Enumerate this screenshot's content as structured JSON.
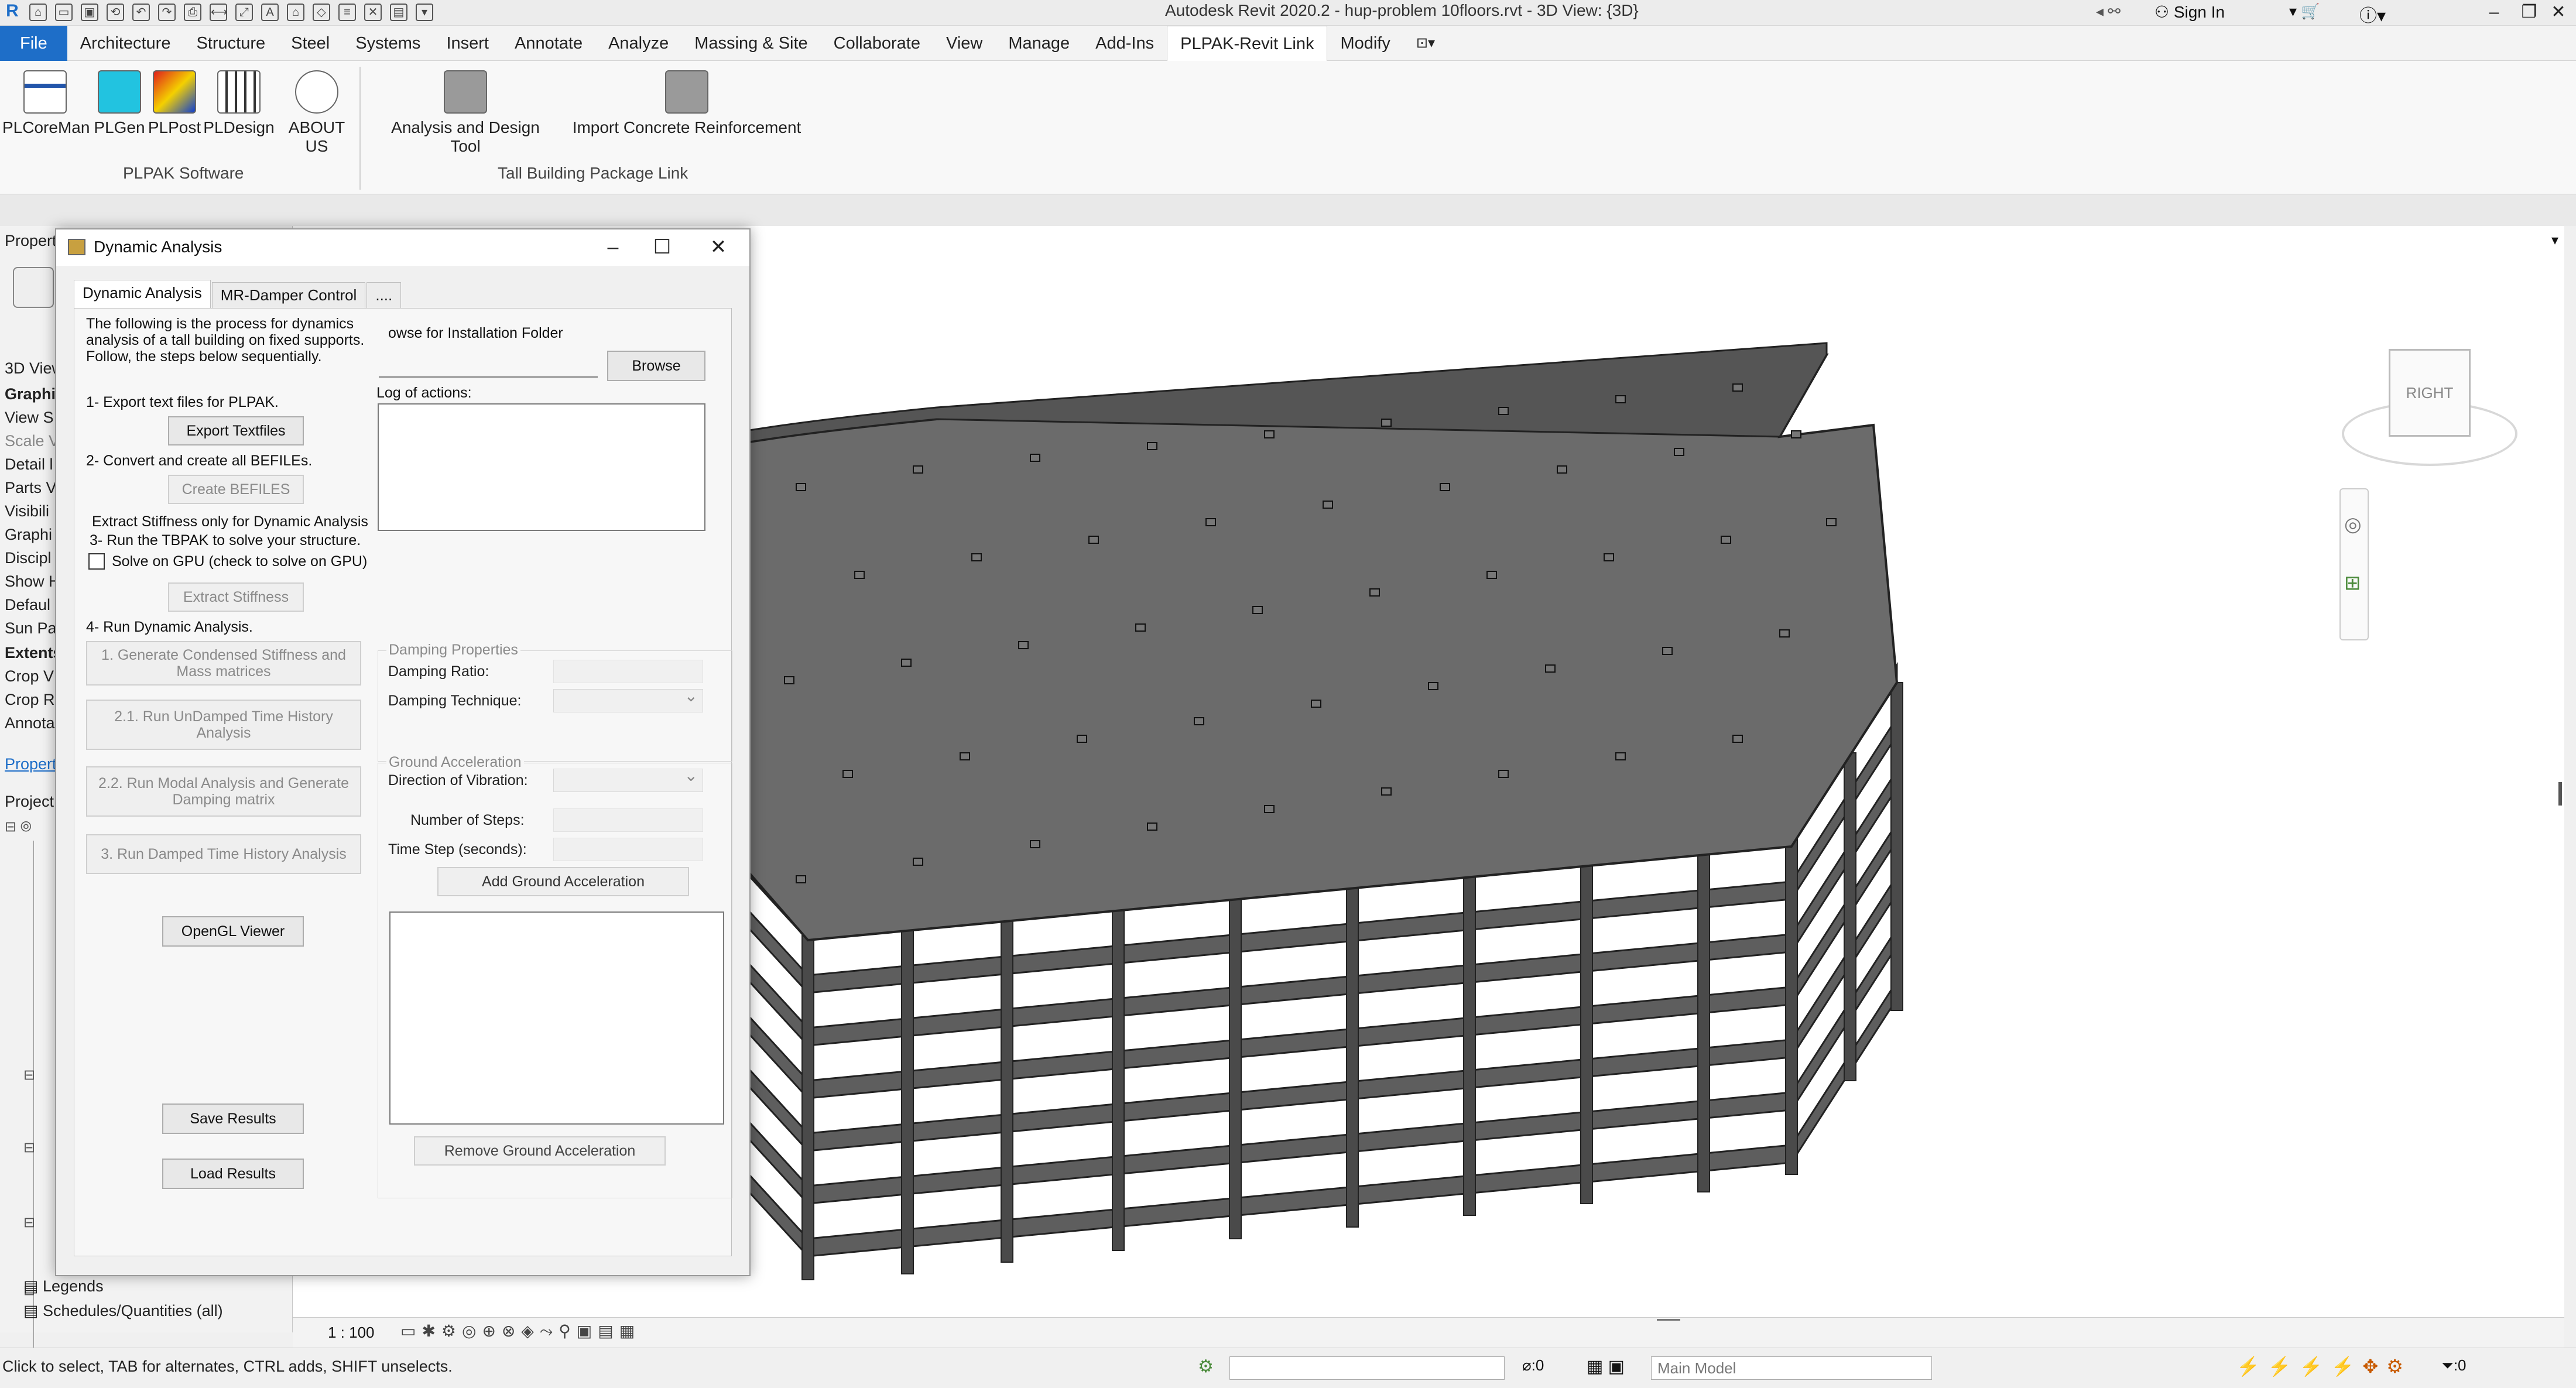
{
  "app": {
    "title": "Autodesk Revit 2020.2 - hup-problem 10floors.rvt - 3D View: {3D}",
    "sign_in": "Sign In"
  },
  "menu": {
    "tabs": [
      "File",
      "Architecture",
      "Structure",
      "Steel",
      "Systems",
      "Insert",
      "Annotate",
      "Analyze",
      "Massing & Site",
      "Collaborate",
      "View",
      "Manage",
      "Add-Ins",
      "PLPAK-Revit Link",
      "Modify"
    ],
    "active": "PLPAK-Revit Link"
  },
  "ribbon": {
    "plpak_buttons": [
      "PLCoreMan",
      "PLGen",
      "PLPost",
      "PLDesign",
      "ABOUT US"
    ],
    "plpak_label": "PLPAK Software",
    "tall_buttons": [
      "Analysis and Design Tool",
      "Import Concrete Reinforcement"
    ],
    "tall_label": "Tall Building Package Link"
  },
  "left_panel": {
    "properties_header": "Propert",
    "view_type": "3D View",
    "items": [
      "Graphic",
      "View S",
      "Scale V",
      "Detail l",
      "Parts V",
      "Visibili",
      "Graphi",
      "Discipl",
      "Show H",
      "Defaul",
      "Sun Pa",
      "Extents",
      "Crop V",
      "Crop R",
      "Annota"
    ],
    "properties_link": "Propert",
    "project_header": "Project",
    "tree": [
      "Legends",
      "Schedules/Quantities (all)"
    ]
  },
  "dialog": {
    "title": "Dynamic Analysis",
    "tabs": [
      "Dynamic Analysis",
      "MR-Damper Control",
      "...."
    ],
    "intro": [
      "The following is the process for dynamics",
      "analysis of a tall building on fixed supports.",
      "Follow, the steps below sequentially."
    ],
    "step1": "1- Export text files for PLPAK.",
    "export_btn": "Export Textfiles",
    "step2": "2- Convert and create all BEFILEs.",
    "befiles_btn": "Create BEFILES",
    "extract_note": "Extract Stiffness only for Dynamic Analysis",
    "step3": "3- Run the TBPAK to solve your structure.",
    "gpu_label": "Solve on GPU (check to solve on GPU)",
    "extract_btn": "Extract Stiffness",
    "step4": "4- Run Dynamic Analysis.",
    "btn_condensed": [
      "1. Generate Condensed Stiffness and",
      "Mass matrices"
    ],
    "btn_undamped": [
      "2.1. Run UnDamped Time History",
      "Analysis"
    ],
    "btn_modal": [
      "2.2. Run Modal Analysis and Generate",
      "Damping matrix"
    ],
    "btn_damped": "3. Run Damped Time History Analysis",
    "opengl_btn": "OpenGL Viewer",
    "save_btn": "Save Results",
    "load_btn": "Load Results",
    "browse_label": "owse for Installation Folder",
    "browse_btn": "Browse",
    "log_label": "Log of actions:",
    "damping_group": "Damping Properties",
    "damping_ratio": "Damping Ratio:",
    "damping_technique": "Damping Technique:",
    "ground_group": "Ground Acceleration",
    "direction": "Direction of Vibration:",
    "num_steps": "Number of Steps:",
    "time_step": "Time Step (seconds):",
    "add_ground_btn": "Add Ground Acceleration",
    "remove_ground_btn": "Remove Ground Acceleration"
  },
  "viewcube": {
    "face": "RIGHT"
  },
  "view_bar": {
    "scale": "1 : 100"
  },
  "status": {
    "message": "Click to select, TAB for alternates, CTRL adds, SHIFT unselects.",
    "count": ":0",
    "model": "Main Model",
    "filter": ":0"
  },
  "colors": {
    "file_tab": "#1e6ec8",
    "building_gray": "#6b6b6b"
  }
}
